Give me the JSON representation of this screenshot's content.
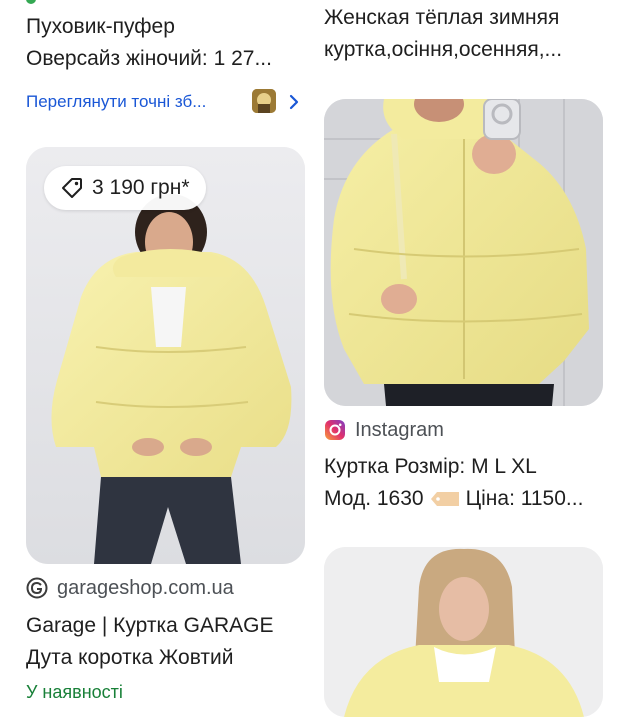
{
  "left_top": {
    "title_line1": "Пуховик-пуфер",
    "title_line2": "Оверсайз жіночий: 1 27...",
    "link_text": "Переглянути точні зб..."
  },
  "right_top": {
    "title_line1": "Женская тёплая зимняя",
    "title_line2": "куртка,осіння,осенняя,..."
  },
  "left_card": {
    "price": "3 190 грн*",
    "source": "garageshop.com.ua",
    "title_line1": "Garage | Куртка GARAGE",
    "title_line2": "Дута коротка Жовтий",
    "availability": "У наявності"
  },
  "right_card": {
    "source": "Instagram",
    "title_line1": "Куртка Розмір: M L XL",
    "title_line2_a": "Мод. 1630",
    "title_line2_b": "Ціна: 1150..."
  },
  "colors": {
    "link": "#1a57d6",
    "availability": "#188038",
    "jacket": "#f6efa0"
  },
  "icons": [
    "price-tag-icon",
    "chevron-right-icon",
    "garage-logo-icon",
    "instagram-icon",
    "thumbnail-icon"
  ]
}
